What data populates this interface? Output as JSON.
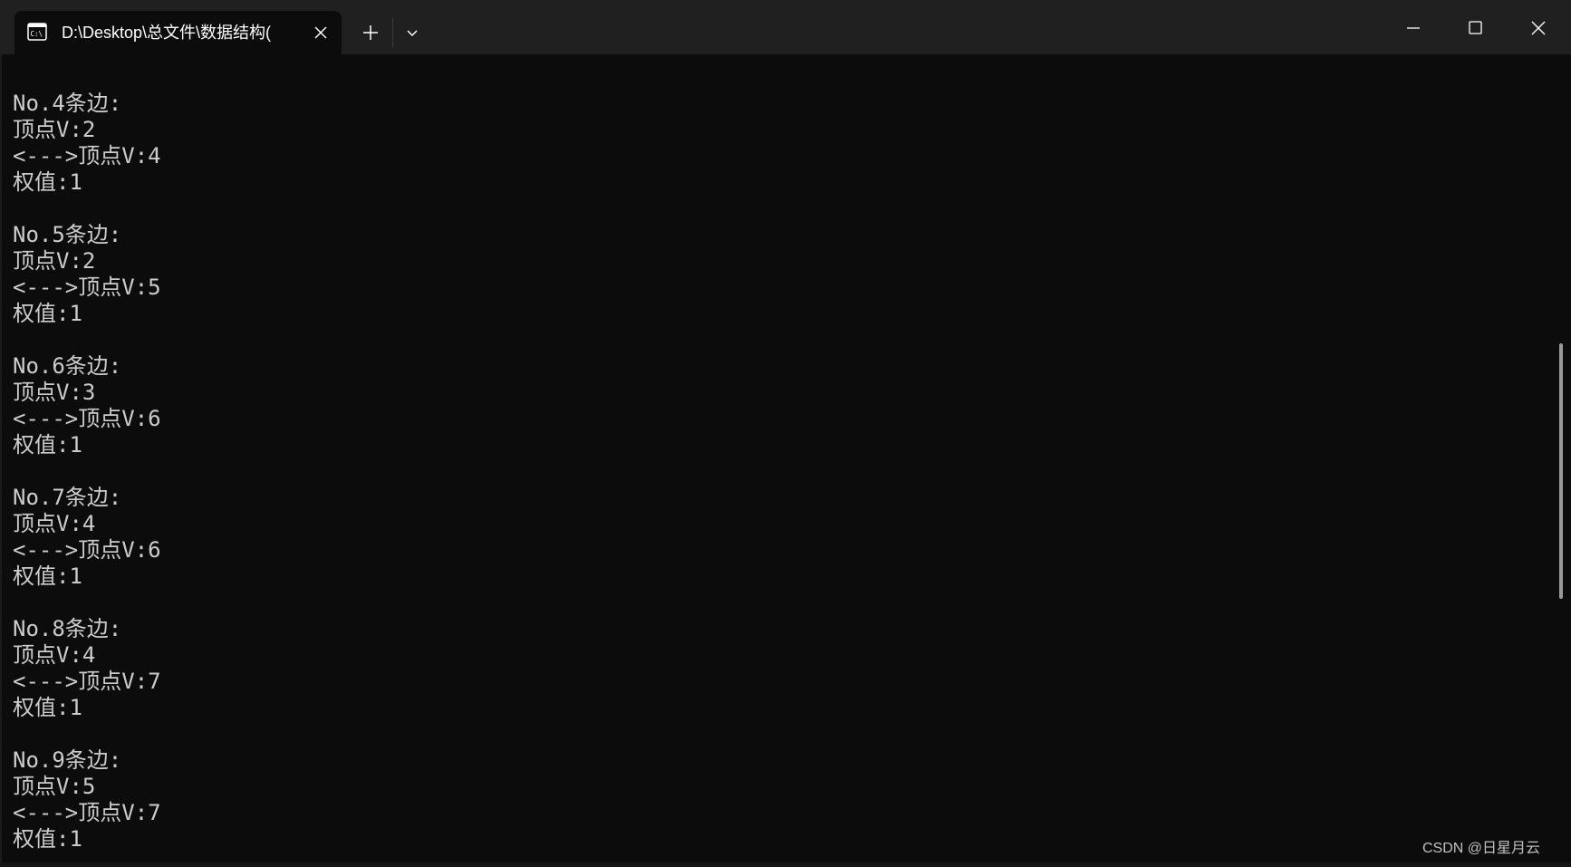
{
  "tab": {
    "title": "D:\\Desktop\\总文件\\数据结构(",
    "icon": "terminal-cmd-icon"
  },
  "titlebar": {
    "new_tab_icon": "plus-icon",
    "dropdown_icon": "chevron-down-icon",
    "minimize_icon": "minimize-icon",
    "maximize_icon": "maximize-icon",
    "close_icon": "close-icon"
  },
  "console": {
    "lines": [
      "No.4条边:",
      "顶点V:2",
      "<--->顶点V:4",
      "权值:1",
      "",
      "No.5条边:",
      "顶点V:2",
      "<--->顶点V:5",
      "权值:1",
      "",
      "No.6条边:",
      "顶点V:3",
      "<--->顶点V:6",
      "权值:1",
      "",
      "No.7条边:",
      "顶点V:4",
      "<--->顶点V:6",
      "权值:1",
      "",
      "No.8条边:",
      "顶点V:4",
      "<--->顶点V:7",
      "权值:1",
      "",
      "No.9条边:",
      "顶点V:5",
      "<--->顶点V:7",
      "权值:1"
    ]
  },
  "watermark": {
    "text": "CSDN @日星月云"
  },
  "colors": {
    "background": "#0c0c0c",
    "titlebar": "#202020",
    "text": "#cccccc"
  }
}
